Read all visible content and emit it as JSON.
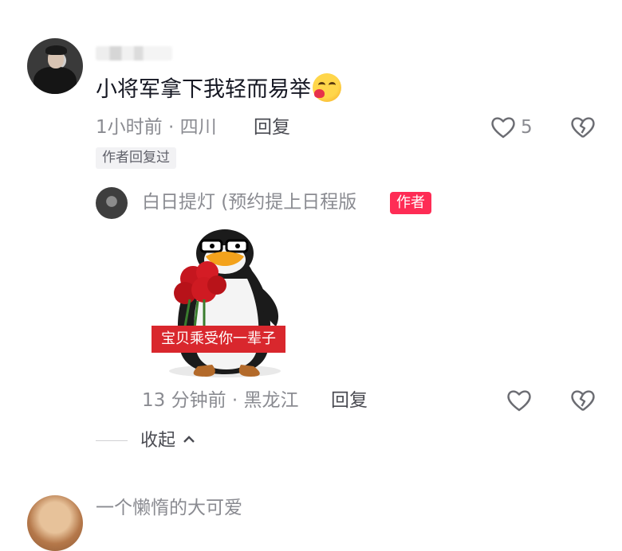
{
  "comment": {
    "text": "小将军拿下我轻而易举",
    "emoji": "kissing-heart-emoji",
    "time_location": "1小时前 · 四川",
    "reply_label": "回复",
    "like_count": "5",
    "author_replied_tag": "作者回复过"
  },
  "reply": {
    "username": "白日提灯 (预约提上日程版",
    "author_badge": "作者",
    "sticker_caption": "宝贝乘受你一辈子",
    "time_location": "13 分钟前 · 黑龙江",
    "reply_label": "回复"
  },
  "collapse_label": "收起",
  "next_comment": {
    "username": "一个懒惰的大可爱"
  },
  "colors": {
    "badge": "#fe2c55",
    "muted_text": "#8a8b91",
    "caption_bg": "#d9272d"
  }
}
